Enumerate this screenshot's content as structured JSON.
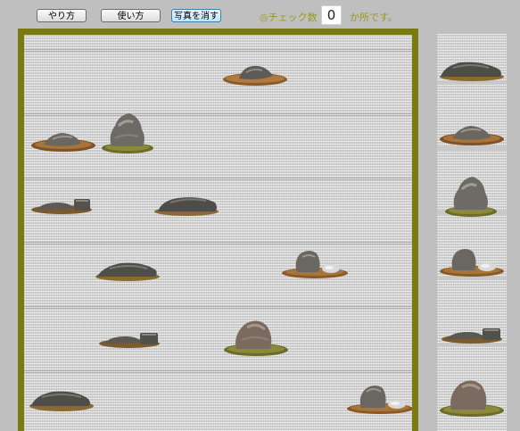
{
  "toolbar": {
    "how_to_play_label": "やり方",
    "usage_label": "使い方",
    "clear_photo_label": "写真を消す"
  },
  "status": {
    "check_label": "◎チェック数",
    "check_count": "0",
    "check_suffix": "か所です。"
  },
  "colors": {
    "frame": "#7a7a12",
    "accent_text": "#9a9a1a",
    "background": "#bfbfbf"
  },
  "garden": {
    "stones": [
      {
        "name": "garden-stone-1",
        "kind": "flat-moss-base"
      },
      {
        "name": "garden-stone-2",
        "kind": "flat-moss-base"
      },
      {
        "name": "garden-stone-3",
        "kind": "tall-with-moss"
      },
      {
        "name": "garden-stone-4",
        "kind": "low-square-pair"
      },
      {
        "name": "garden-stone-5",
        "kind": "long-low"
      },
      {
        "name": "garden-stone-6",
        "kind": "long-low"
      },
      {
        "name": "garden-stone-7",
        "kind": "upright-with-pebble"
      },
      {
        "name": "garden-stone-8",
        "kind": "low-square-pair"
      },
      {
        "name": "garden-stone-9",
        "kind": "tall-rounded-moss"
      },
      {
        "name": "garden-stone-10",
        "kind": "long-low"
      },
      {
        "name": "garden-stone-11",
        "kind": "upright-with-pebble"
      }
    ]
  },
  "sidebar": {
    "stones": [
      {
        "name": "palette-stone-1",
        "kind": "long-low"
      },
      {
        "name": "palette-stone-2",
        "kind": "flat-moss-base"
      },
      {
        "name": "palette-stone-3",
        "kind": "tall-with-moss"
      },
      {
        "name": "palette-stone-4",
        "kind": "upright-with-pebble"
      },
      {
        "name": "palette-stone-5",
        "kind": "low-square-pair"
      },
      {
        "name": "palette-stone-6",
        "kind": "tall-rounded-moss"
      }
    ]
  }
}
